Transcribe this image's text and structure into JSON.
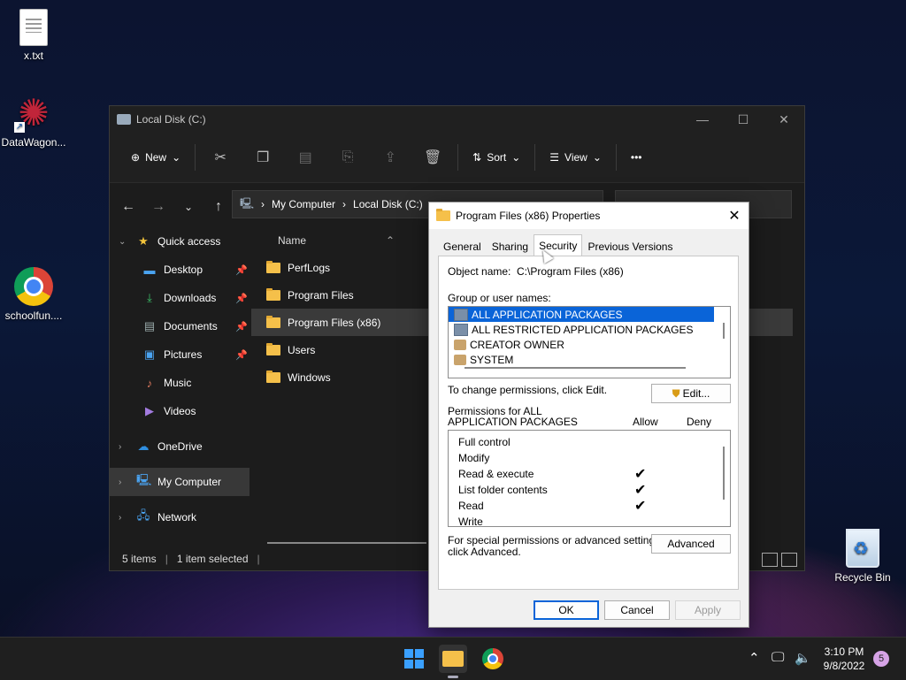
{
  "desktop": {
    "icons": [
      {
        "label": "x.txt",
        "icon": "text-file-icon"
      },
      {
        "label": "DataWagon...",
        "icon": "datawagon-shortcut-icon"
      },
      {
        "label": "schoolfun....",
        "icon": "chrome-icon"
      },
      {
        "label": "Recycle Bin",
        "icon": "recycle-bin-icon"
      }
    ]
  },
  "explorer": {
    "title": "Local Disk (C:)",
    "toolbar": {
      "new_label": "New",
      "sort_label": "Sort",
      "view_label": "View",
      "more_label": "•••"
    },
    "breadcrumb": [
      "My Computer",
      "Local Disk (C:)"
    ],
    "column_header": "Name",
    "sidebar": [
      {
        "label": "Quick access",
        "icon": "star-icon",
        "level": "top"
      },
      {
        "label": "Desktop",
        "icon": "desktop-icon",
        "pinned": true
      },
      {
        "label": "Downloads",
        "icon": "download-icon",
        "pinned": true
      },
      {
        "label": "Documents",
        "icon": "documents-icon",
        "pinned": true
      },
      {
        "label": "Pictures",
        "icon": "pictures-icon",
        "pinned": true
      },
      {
        "label": "Music",
        "icon": "music-icon",
        "pinned": false
      },
      {
        "label": "Videos",
        "icon": "videos-icon",
        "pinned": false
      },
      {
        "label": "OneDrive",
        "icon": "onedrive-icon",
        "level": "top"
      },
      {
        "label": "My Computer",
        "icon": "computer-icon",
        "level": "top",
        "selected": true
      },
      {
        "label": "Network",
        "icon": "network-icon",
        "level": "top"
      }
    ],
    "files": [
      {
        "name": "PerfLogs"
      },
      {
        "name": "Program Files"
      },
      {
        "name": "Program Files (x86)",
        "selected": true
      },
      {
        "name": "Users"
      },
      {
        "name": "Windows"
      }
    ],
    "status": {
      "items": "5 items",
      "selected": "1 item selected"
    }
  },
  "dialog": {
    "title": "Program Files (x86) Properties",
    "tabs": [
      "General",
      "Sharing",
      "Security",
      "Previous Versions"
    ],
    "active_tab": "Security",
    "object_name_label": "Object name:",
    "object_name_value": "C:\\Program Files (x86)",
    "group_label": "Group or user names:",
    "groups": [
      {
        "name": "ALL APPLICATION PACKAGES",
        "selected": true
      },
      {
        "name": "ALL RESTRICTED APPLICATION PACKAGES"
      },
      {
        "name": "CREATOR OWNER"
      },
      {
        "name": "SYSTEM"
      }
    ],
    "change_text": "To change permissions, click Edit.",
    "edit_label": "Edit...",
    "perm_label_line1": "Permissions for ALL",
    "perm_label_line2": "APPLICATION PACKAGES",
    "allow_label": "Allow",
    "deny_label": "Deny",
    "permissions": [
      {
        "name": "Full control",
        "allow": false
      },
      {
        "name": "Modify",
        "allow": false
      },
      {
        "name": "Read & execute",
        "allow": true
      },
      {
        "name": "List folder contents",
        "allow": true
      },
      {
        "name": "Read",
        "allow": true
      },
      {
        "name": "Write",
        "allow": false
      }
    ],
    "check_glyph": "✔",
    "special_line1": "For special permissions or advanced settings,",
    "special_line2": "click Advanced.",
    "advanced_label": "Advanced",
    "ok_label": "OK",
    "cancel_label": "Cancel",
    "apply_label": "Apply"
  },
  "taskbar": {
    "time": "3:10 PM",
    "date": "9/8/2022",
    "notification_count": "5"
  }
}
